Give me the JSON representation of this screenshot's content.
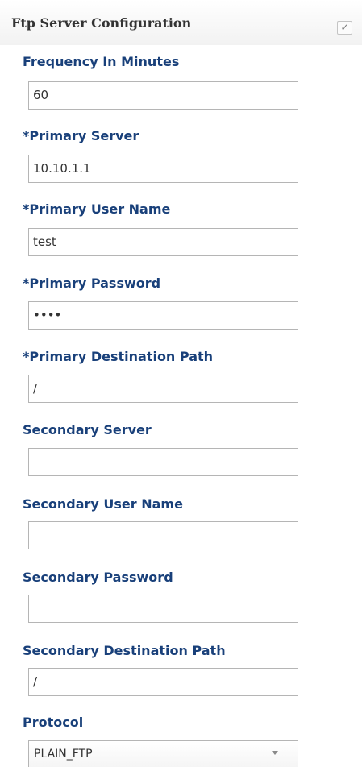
{
  "section": {
    "title": "Ftp Server Configuration",
    "checked": true,
    "check_icon": "checkmark-icon"
  },
  "fields": {
    "frequency": {
      "label": "Frequency In Minutes",
      "value": "60"
    },
    "primary_server": {
      "label": "*Primary Server",
      "value": "10.10.1.1"
    },
    "primary_user": {
      "label": "*Primary User Name",
      "value": "test"
    },
    "primary_password": {
      "label": "*Primary Password",
      "value": "••••"
    },
    "primary_path": {
      "label": "*Primary Destination Path",
      "value": "/"
    },
    "secondary_server": {
      "label": "Secondary Server",
      "value": ""
    },
    "secondary_user": {
      "label": "Secondary User Name",
      "value": ""
    },
    "secondary_password": {
      "label": "Secondary Password",
      "value": ""
    },
    "secondary_path": {
      "label": "Secondary Destination Path",
      "value": "/"
    },
    "protocol": {
      "label": "Protocol",
      "value": "PLAIN_FTP",
      "dropdown_icon": "chevron-down-icon"
    }
  },
  "colors": {
    "label": "#19407a",
    "title": "#333333",
    "input_border": "#b5b5b5"
  }
}
